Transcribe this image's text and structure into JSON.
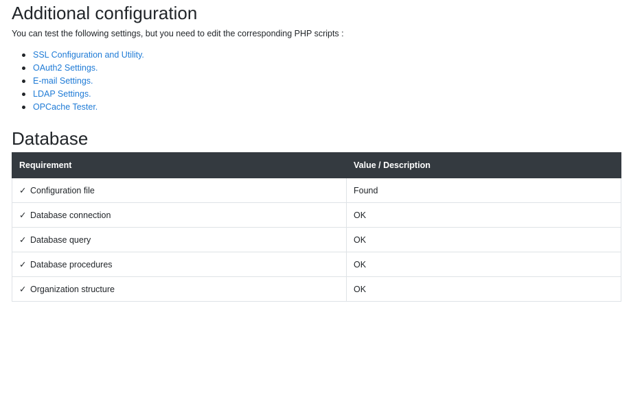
{
  "additional": {
    "title": "Additional configuration",
    "intro": "You can test the following settings, but you need to edit the corresponding PHP scripts :",
    "links": [
      {
        "label": "SSL Configuration and Utility."
      },
      {
        "label": "OAuth2 Settings."
      },
      {
        "label": "E-mail Settings."
      },
      {
        "label": "LDAP Settings."
      },
      {
        "label": "OPCache Tester."
      }
    ]
  },
  "database": {
    "title": "Database",
    "headers": {
      "requirement": "Requirement",
      "value": "Value / Description"
    },
    "rows": [
      {
        "status_icon": "check-icon",
        "requirement": "Configuration file",
        "value": "Found"
      },
      {
        "status_icon": "check-icon",
        "requirement": "Database connection",
        "value": "OK"
      },
      {
        "status_icon": "check-icon",
        "requirement": "Database query",
        "value": "OK"
      },
      {
        "status_icon": "check-icon",
        "requirement": "Database procedures",
        "value": "OK"
      },
      {
        "status_icon": "check-icon",
        "requirement": "Organization structure",
        "value": "OK"
      }
    ]
  },
  "colors": {
    "link": "#1f7bd6",
    "table_header_bg": "#343a40",
    "border": "#dee2e6"
  }
}
